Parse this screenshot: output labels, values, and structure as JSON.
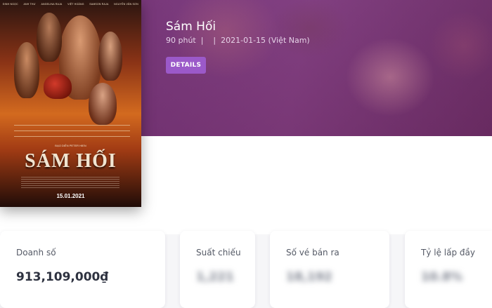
{
  "movie": {
    "title": "Sám Hối",
    "meta": "90 phút  |    |  2021-01-15 (Việt Nam)",
    "details_button": "DETAILS"
  },
  "poster": {
    "title": "SÁM HỐI",
    "director_line": "ĐẠO DIỄN PETER HIEN",
    "date": "15.01.2021",
    "cast": [
      "ĐINH NGỌC",
      "ANH THƯ",
      "ANGELINA RAJA",
      "VIỆT HOÀNG",
      "SAMSON RAJA",
      "NGUYỄN VĂN SƠN"
    ]
  },
  "stats": [
    {
      "label": "Doanh số",
      "value": "913,109,000₫"
    },
    {
      "label": "Suất chiếu",
      "value": "1,221"
    },
    {
      "label": "Số vé bán ra",
      "value": "18,192"
    },
    {
      "label": "Tỷ lệ lấp đầy",
      "value": "10.8%"
    }
  ]
}
